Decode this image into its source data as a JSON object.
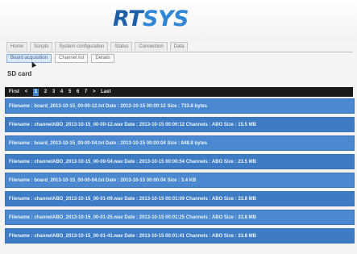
{
  "logo": {
    "rt": "RT",
    "sys": "SYS"
  },
  "nav": {
    "tabs": [
      "Home",
      "Scripts",
      "System configuration",
      "Status",
      "Connection",
      "Data"
    ]
  },
  "subnav": {
    "buttons": [
      "Board acquisition",
      "Channel list",
      "Details"
    ]
  },
  "sd_card": {
    "label": "SD card"
  },
  "pager": {
    "first": "First",
    "prev": "<",
    "current": "1",
    "pages": [
      "2",
      "3",
      "4",
      "5",
      "6",
      "7"
    ],
    "next": ">",
    "last": "Last"
  },
  "files": [
    "Filename : board_2013-10-15_00-00-12.txt   Date : 2013-10-15 00:00:12   Size : 733.8 bytes",
    "Filename : channelABO_2013-10-15_00-00-12.wav   Date : 2013-10-15 00:00:12   Channels : ABO   Size : 15.5 MB",
    "Filename : board_2013-10-15_00-00-04.txt   Date : 2013-10-15 00:00:04   Size : 848.8 bytes",
    "Filename : channelABO_2013-10-15_00-00-54.wav   Date : 2013-10-15 00:00:54   Channels : ABO   Size : 23.5 MB",
    "Filename : board_2013-10-15_00-00-04.txt   Date : 2013-10-15 00:00:04   Size : 3.4 KB",
    "Filename : channelABO_2013-10-15_00-01-09.wav   Date : 2013-10-15 00:01:09   Channels : ABO   Size : 33.8 MB",
    "Filename : channelABO_2013-10-15_00-01-25.wav   Date : 2013-10-15 00:01:25   Channels : ABO   Size : 33.8 MB",
    "Filename : channelABO_2013-10-15_00-01-41.wav   Date : 2013-10-15 00:01:41   Channels : ABO   Size : 33.8 MB"
  ]
}
